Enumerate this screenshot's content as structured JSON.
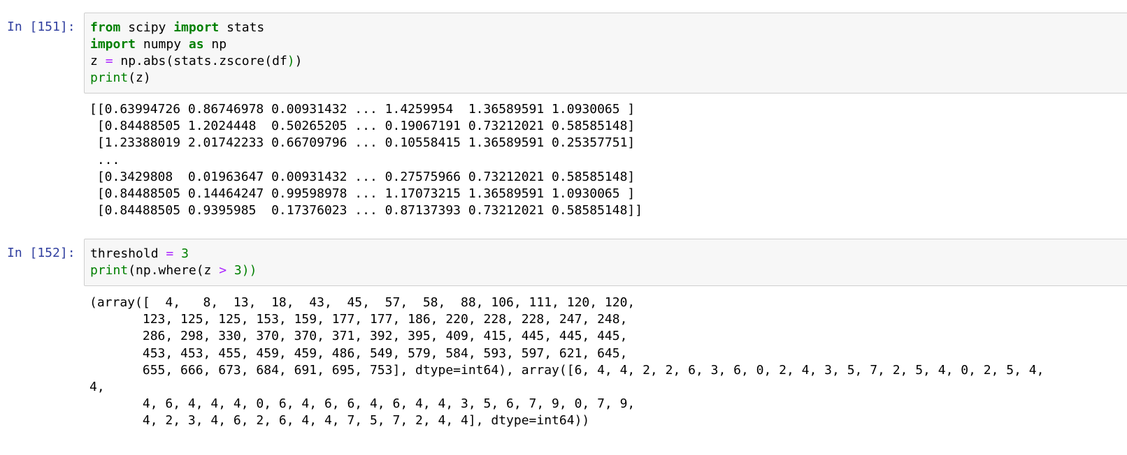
{
  "cells": [
    {
      "prompt": "In [151]:",
      "code": [
        [
          {
            "t": "from",
            "c": "kw"
          },
          {
            "t": " scipy ",
            "c": ""
          },
          {
            "t": "import",
            "c": "kw"
          },
          {
            "t": " stats",
            "c": ""
          }
        ],
        [
          {
            "t": "import",
            "c": "kw"
          },
          {
            "t": " numpy ",
            "c": ""
          },
          {
            "t": "as",
            "c": "kw"
          },
          {
            "t": " np",
            "c": ""
          }
        ],
        [
          {
            "t": "z ",
            "c": ""
          },
          {
            "t": "=",
            "c": "op"
          },
          {
            "t": " np.abs(stats.zscore(df",
            "c": ""
          },
          {
            "t": ")",
            "c": "paren"
          },
          {
            "t": ")",
            "c": ""
          }
        ],
        [
          {
            "t": "print",
            "c": "bi"
          },
          {
            "t": "(z)",
            "c": ""
          }
        ]
      ],
      "output": [
        "[[0.63994726 0.86746978 0.00931432 ... 1.4259954  1.36589591 1.0930065 ]",
        " [0.84488505 1.2024448  0.50265205 ... 0.19067191 0.73212021 0.58585148]",
        " [1.23388019 2.01742233 0.66709796 ... 0.10558415 1.36589591 0.25357751]",
        " ...",
        " [0.3429808  0.01963647 0.00931432 ... 0.27575966 0.73212021 0.58585148]",
        " [0.84488505 0.14464247 0.99598978 ... 1.17073215 1.36589591 1.0930065 ]",
        " [0.84488505 0.9395985  0.17376023 ... 0.87137393 0.73212021 0.58585148]]"
      ]
    },
    {
      "prompt": "In [152]:",
      "code": [
        [
          {
            "t": "threshold ",
            "c": ""
          },
          {
            "t": "=",
            "c": "op"
          },
          {
            "t": " ",
            "c": ""
          },
          {
            "t": "3",
            "c": "num"
          }
        ],
        [
          {
            "t": "print",
            "c": "bi"
          },
          {
            "t": "(np.where(z ",
            "c": ""
          },
          {
            "t": ">",
            "c": "op"
          },
          {
            "t": " ",
            "c": ""
          },
          {
            "t": "3",
            "c": "num"
          },
          {
            "t": "))",
            "c": "paren"
          }
        ]
      ],
      "output": [
        "(array([  4,   8,  13,  18,  43,  45,  57,  58,  88, 106, 111, 120, 120,",
        "       123, 125, 125, 153, 159, 177, 177, 186, 220, 228, 228, 247, 248,",
        "       286, 298, 330, 370, 370, 371, 392, 395, 409, 415, 445, 445, 445,",
        "       453, 453, 455, 459, 459, 486, 549, 579, 584, 593, 597, 621, 645,",
        "       655, 666, 673, 684, 691, 695, 753], dtype=int64), array([6, 4, 4, 2, 2, 6, 3, 6, 0, 2, 4, 3, 5, 7, 2, 5, 4, 0, 2, 5, 4,",
        "4,",
        "       4, 6, 4, 4, 4, 0, 6, 4, 6, 6, 4, 6, 4, 4, 3, 5, 6, 7, 9, 0, 7, 9,",
        "       4, 2, 3, 4, 6, 2, 6, 4, 4, 7, 5, 7, 2, 4, 4], dtype=int64))"
      ]
    }
  ]
}
